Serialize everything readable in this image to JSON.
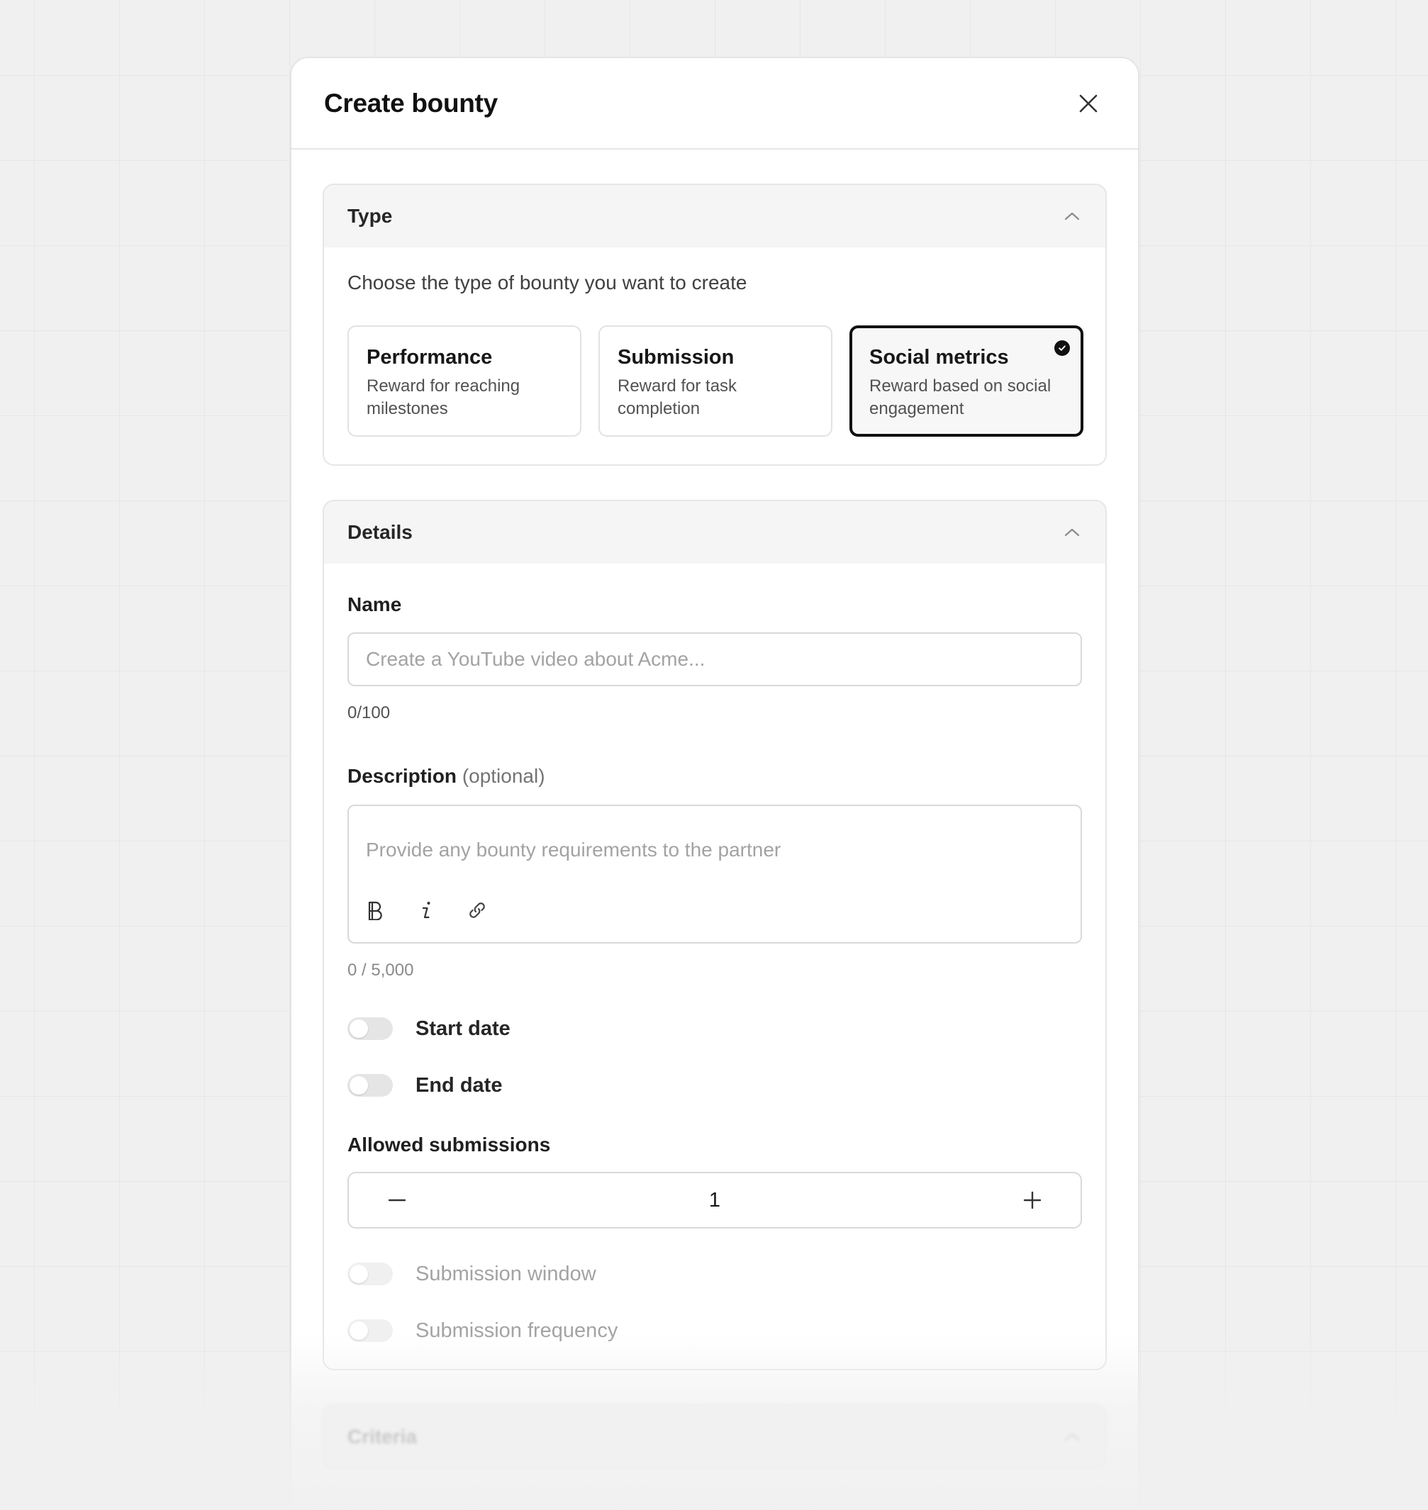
{
  "modal": {
    "title": "Create bounty"
  },
  "type_section": {
    "title": "Type",
    "prompt": "Choose the type of bounty you want to create",
    "options": [
      {
        "title": "Performance",
        "description": "Reward for reaching milestones",
        "selected": false
      },
      {
        "title": "Submission",
        "description": "Reward for task completion",
        "selected": false
      },
      {
        "title": "Social metrics",
        "description": "Reward based on social engagement",
        "selected": true
      }
    ]
  },
  "details_section": {
    "title": "Details",
    "name": {
      "label": "Name",
      "placeholder": "Create a YouTube video about Acme...",
      "value": "",
      "counter": "0/100"
    },
    "description": {
      "label": "Description",
      "optional": "(optional)",
      "placeholder": "Provide any bounty requirements to the partner",
      "counter": "0 / 5,000"
    },
    "start_date": {
      "label": "Start date",
      "enabled": false
    },
    "end_date": {
      "label": "End date",
      "enabled": false
    },
    "allowed_submissions": {
      "label": "Allowed submissions",
      "value": "1"
    },
    "submission_window": {
      "label": "Submission window",
      "enabled": false,
      "disabled": true
    },
    "submission_frequency": {
      "label": "Submission frequency",
      "enabled": false,
      "disabled": true
    }
  },
  "criteria_section": {
    "title": "Criteria"
  },
  "icons": {
    "close": "close-icon",
    "collapse": "chevron-up-icon",
    "selected": "check-circle-icon",
    "bold": "bold-icon",
    "italic": "italic-icon",
    "link": "link-icon",
    "decrement": "minus-icon",
    "increment": "plus-icon"
  },
  "colors": {
    "selected_border": "#111111",
    "section_header_bg": "#f5f5f5",
    "placeholder": "#a3a3a3"
  }
}
